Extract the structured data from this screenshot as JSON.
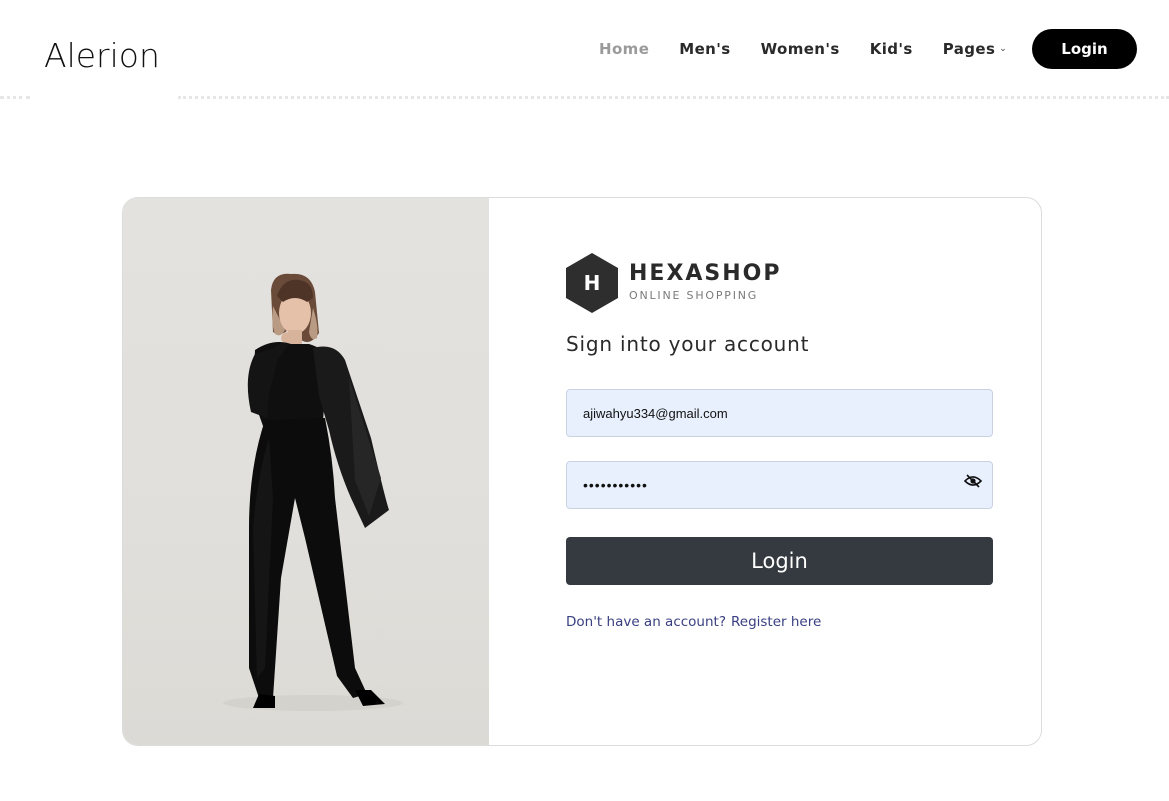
{
  "brand": {
    "name": "Alerion"
  },
  "nav": {
    "items": [
      {
        "label": "Home"
      },
      {
        "label": "Men's"
      },
      {
        "label": "Women's"
      },
      {
        "label": "Kid's"
      },
      {
        "label": "Pages"
      }
    ],
    "active": "Home",
    "login_label": "Login"
  },
  "card": {
    "logo": {
      "letter": "H",
      "title": "HEXASHOP",
      "subtitle": "ONLINE SHOPPING"
    },
    "heading": "Sign into your account",
    "email": {
      "value": "ajiwahyu334@gmail.com"
    },
    "password": {
      "value": "•••••••••••"
    },
    "submit_label": "Login",
    "register": {
      "prompt": "Don't have an account?",
      "link": "Register here"
    }
  },
  "colors": {
    "button_dark": "#343a40",
    "input_bg": "#e8f0fe",
    "link": "#393f81",
    "nav_active": "#9a9a9a"
  },
  "icons": [
    "chevron-down-icon",
    "hexagon-logo-icon",
    "eye-slash-icon"
  ]
}
